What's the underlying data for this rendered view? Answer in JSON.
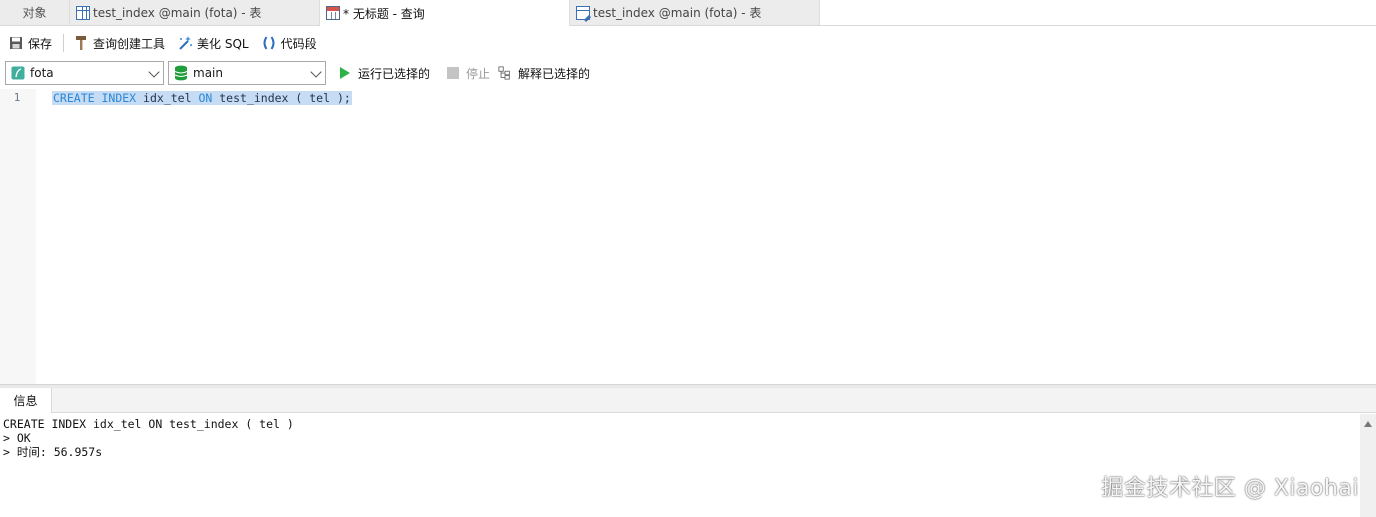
{
  "tabs": {
    "objects": "对象",
    "table_tab_1": "test_index @main (fota) - 表",
    "query_tab": "* 无标题 - 查询",
    "table_tab_2": "test_index @main (fota) - 表"
  },
  "toolbar": {
    "save": "保存",
    "query_builder": "查询创建工具",
    "beautify": "美化 SQL",
    "snippet": "代码段"
  },
  "selectors": {
    "connection": "fota",
    "database": "main"
  },
  "actions": {
    "run_selected": "运行已选择的",
    "stop": "停止",
    "explain_selected": "解释已选择的"
  },
  "editor": {
    "line_number": "1",
    "kw_create": "CREATE",
    "kw_index": "INDEX",
    "index_name": "idx_tel",
    "kw_on": "ON",
    "rest": "test_index ( tel );"
  },
  "info": {
    "tab_label": "信息",
    "lines": [
      "CREATE INDEX idx_tel ON test_index ( tel )",
      "> OK",
      "> 时间: 56.957s"
    ]
  },
  "watermark": "掘金技术社区 @ Xiaohai",
  "colors": {
    "keyword": "#2a86d6",
    "selection": "#c5dcf4",
    "run_green": "#2db34a",
    "db_green": "#1f9d3a"
  }
}
